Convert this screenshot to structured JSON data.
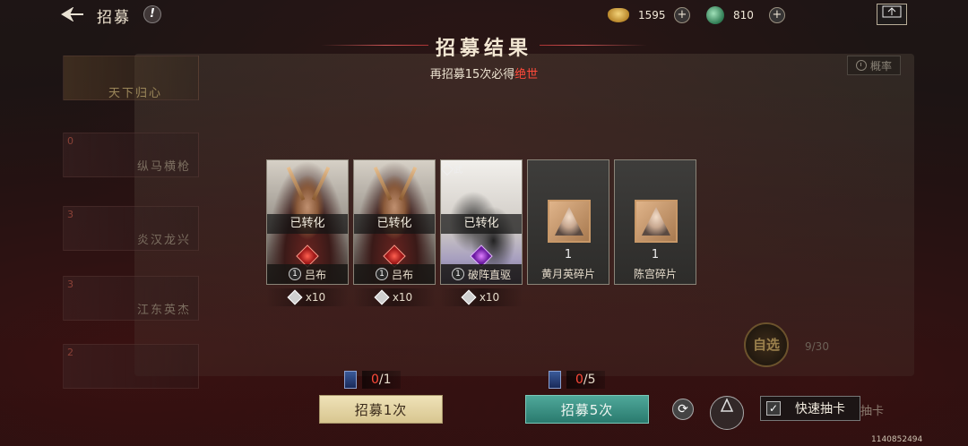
{
  "topbar": {
    "title": "招募",
    "info_glyph": "!",
    "back_icon": "back-arrow-icon",
    "gold_value": "1595",
    "jade_value": "810",
    "plus_glyph": "+"
  },
  "result": {
    "title": "招募结果",
    "sub_prefix": "再招募15次必得",
    "sub_highlight": "绝世"
  },
  "side_list": [
    {
      "num": "",
      "label": "天下归心"
    },
    {
      "num": "0",
      "label": "纵马横枪"
    },
    {
      "num": "3",
      "label": "炎汉龙兴"
    },
    {
      "num": "3",
      "label": "江东英杰"
    },
    {
      "num": "2",
      "label": ""
    }
  ],
  "prob_label": "概率",
  "self_select": {
    "label": "自选",
    "count": "9/30"
  },
  "cards": [
    {
      "type": "hero",
      "status": "已转化",
      "badge": "1",
      "name": "吕布",
      "reward": "x10"
    },
    {
      "type": "hero",
      "status": "已转化",
      "badge": "1",
      "name": "吕布",
      "reward": "x10"
    },
    {
      "type": "skill",
      "tag": "武",
      "status": "已转化",
      "badge": "1",
      "name": "破阵直驱",
      "reward": "x10"
    },
    {
      "type": "shard",
      "count": "1",
      "name": "黄月英碎片"
    },
    {
      "type": "shard",
      "count": "1",
      "name": "陈宫碎片"
    }
  ],
  "bottom": {
    "ticket1_used": "0",
    "ticket1_total": "/1",
    "ticket5_used": "0",
    "ticket5_total": "/5",
    "btn_one": "招募1次",
    "btn_five": "招募5次",
    "quick_draw": "快速抽卡",
    "quick_draw_checked": "✓",
    "ghost_label": "抽卡",
    "uid": "1140852494"
  },
  "colors": {
    "accent_red": "#ff4a3a",
    "teal_button": "#2a7a6e",
    "cream_button": "#efe2b8"
  }
}
